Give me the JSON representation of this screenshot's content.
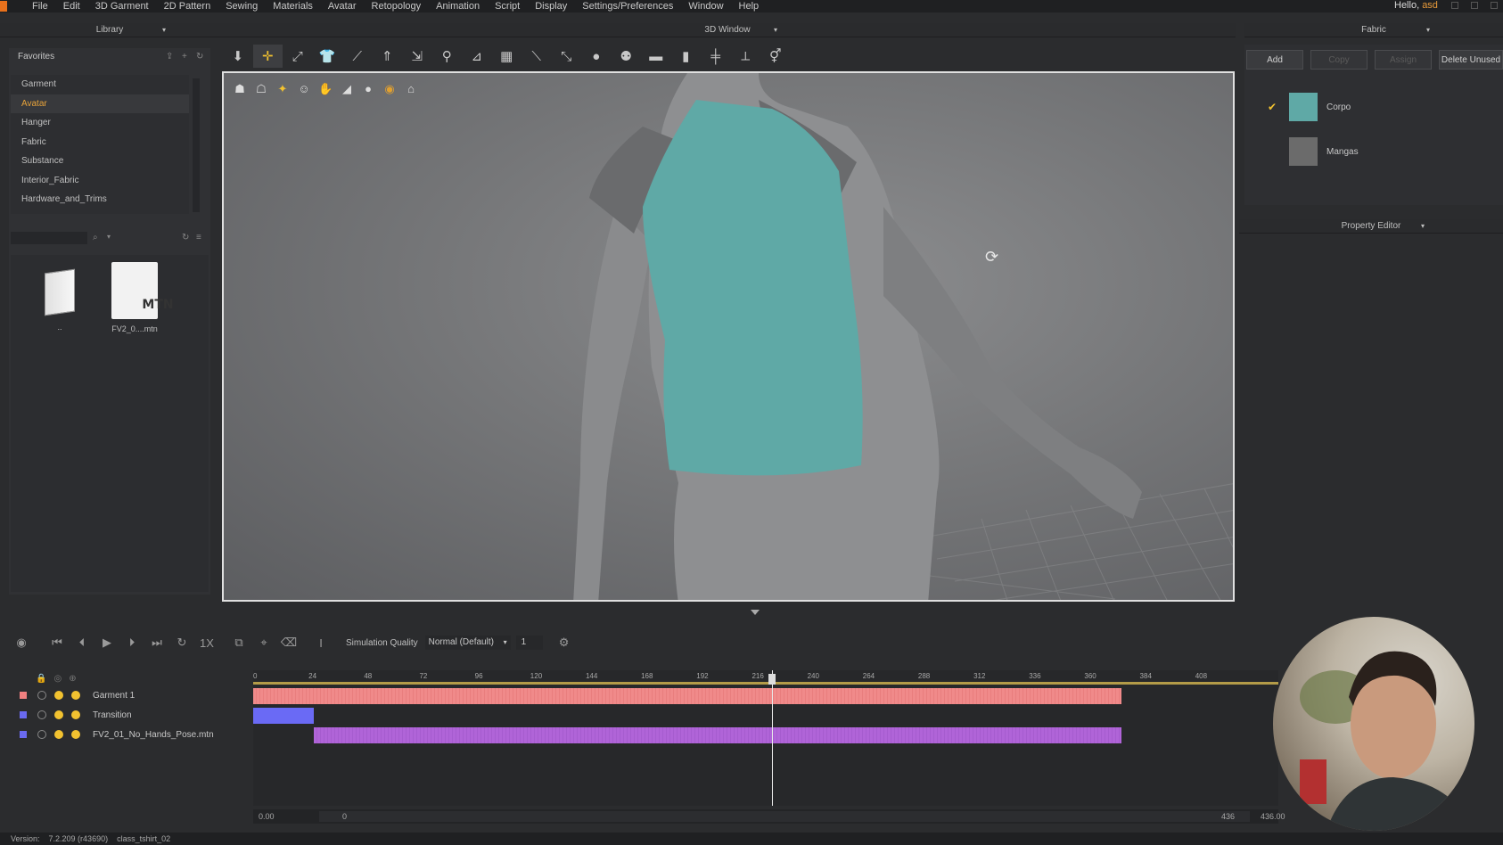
{
  "menubar": {
    "items": [
      "File",
      "Edit",
      "3D Garment",
      "2D Pattern",
      "Sewing",
      "Materials",
      "Avatar",
      "Retopology",
      "Animation",
      "Script",
      "Display",
      "Settings/Preferences",
      "Window",
      "Help"
    ],
    "greeting": "Hello,",
    "user": "asd"
  },
  "library": {
    "title": "Library",
    "favorites_label": "Favorites",
    "items": [
      "Garment",
      "Avatar",
      "Hanger",
      "Fabric",
      "Substance",
      "Interior_Fabric",
      "Hardware_and_Trims"
    ],
    "active_item": "Avatar",
    "files": [
      {
        "label": "..",
        "icon": "folder-up-icon"
      },
      {
        "label": "FV2_0....mtn",
        "badge": "MTN",
        "icon": "mtn-file-icon"
      }
    ]
  },
  "window3d": {
    "title": "3D Window"
  },
  "fabric": {
    "title": "Fabric",
    "buttons": {
      "add": "Add",
      "copy": "Copy",
      "assign": "Assign",
      "delete": "Delete Unused"
    },
    "list": [
      {
        "name": "Corpo",
        "color": "#5fa9a6",
        "checked": true
      },
      {
        "name": "Mangas",
        "color": "#6b6b6b",
        "checked": false
      }
    ]
  },
  "property_editor": {
    "title": "Property Editor"
  },
  "animation": {
    "speed": "1X",
    "sim_quality_label": "Simulation Quality",
    "sim_quality_value": "Normal (Default)",
    "sim_step": "1",
    "ruler_ticks": [
      "0",
      "24",
      "48",
      "72",
      "96",
      "120",
      "144",
      "168",
      "192",
      "216",
      "240",
      "264",
      "288",
      "312",
      "336",
      "360",
      "384",
      "408"
    ],
    "tracks": [
      {
        "name": "Garment 1",
        "color": "#f08080",
        "bar_color": "#f08a8a"
      },
      {
        "name": "Transition",
        "color": "#6a6af0",
        "bar_color": "#6a6af5"
      },
      {
        "name": "FV2_01_No_Hands_Pose.mtn",
        "color": "#6a6af0",
        "bar_color": "#b064d8"
      }
    ],
    "range_start": "0.00",
    "range_inner_start": "0",
    "range_inner_end": "436",
    "range_end": "436.00",
    "playhead_frame": 207
  },
  "status": {
    "version_label": "Version:",
    "version": "7.2.209 (r43690)",
    "file": "class_tshirt_02"
  },
  "colors": {
    "accent": "#f2c230",
    "active_text": "#e8a33a",
    "shirt": "#5fa9a6"
  }
}
